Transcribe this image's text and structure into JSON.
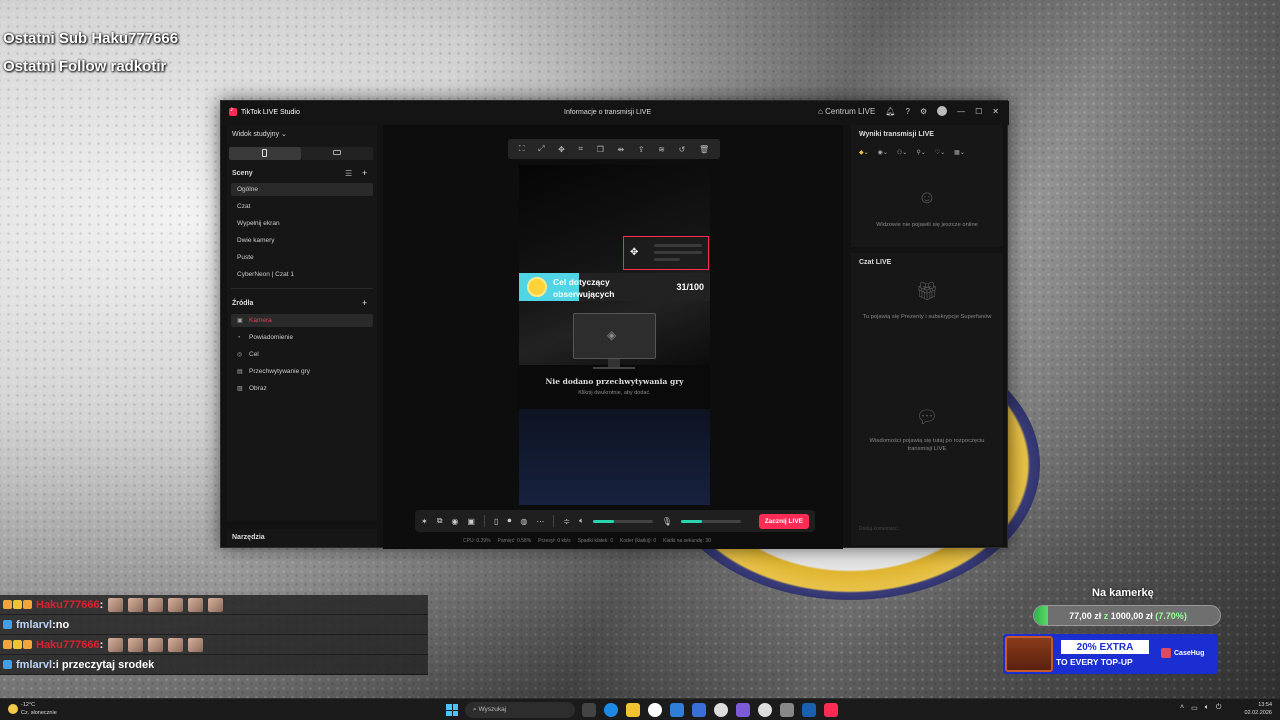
{
  "overlay": {
    "last_sub": "Ostatni Sub Haku777666",
    "last_follow": "Ostatni Follow radkotir"
  },
  "window": {
    "app_title": "TikTok LIVE Studio",
    "center_title": "Informacje o transmisji LIVE",
    "live_center": "Centrum LIVE"
  },
  "sidebar": {
    "view_dropdown": "Widok studyjny",
    "scenes_label": "Sceny",
    "scenes": [
      "Ogólne",
      "Czat",
      "Wypełnij ekran",
      "Dwie kamery",
      "Puste",
      "CyberNeon | Czat 1"
    ],
    "sources_label": "Źródła",
    "sources": [
      {
        "label": "Kamera",
        "icon": "camera-icon"
      },
      {
        "label": "Powiadomienie",
        "icon": "bell-icon"
      },
      {
        "label": "Cel",
        "icon": "target-icon"
      },
      {
        "label": "Przechwytywanie gry",
        "icon": "gamepad-icon"
      },
      {
        "label": "Obraz",
        "icon": "image-icon"
      }
    ],
    "tools_label": "Narzędzia"
  },
  "preview": {
    "goal_text": "Cel dotyczący obserwujących",
    "goal_count": "31/100",
    "game_title": "Nie dodano przechwytywania gry",
    "game_sub": "Kliknij dwukrotnie, aby dodać."
  },
  "controls": {
    "live_button": "Zacznij LIVE",
    "speaker_level": 0.35,
    "mic_level": 0.35
  },
  "stats": {
    "cpu": "CPU: 0.39%",
    "memory": "Pamięć: 0.58%",
    "bandwidth": "Przesył: 0 kb/s",
    "dropped": "Spadki klatek: 0",
    "encoder": "Koder (klatkiį): 0",
    "fps": "Klatki na sekundę: 30"
  },
  "right": {
    "results_title": "Wyniki transmisji LIVE",
    "results_empty": "Widzowie nie pojawili się jeszcze online",
    "chat_title": "Czat LIVE",
    "gifts_empty": "Tu pojawią się Prezenty i subskrypcje Superfanów",
    "messages_empty": "Wiadomości pojawią się tutaj po rozpoczęciu transmisji LIVE",
    "chat_placeholder": "Dodaj komentarz..."
  },
  "chat": [
    {
      "user": "Haku777666",
      "color": "red",
      "msg": "",
      "emotes": 6
    },
    {
      "user": "fmlarvl",
      "color": "blue",
      "msg": "no",
      "emotes": 0
    },
    {
      "user": "Haku777666",
      "color": "red",
      "msg": "",
      "emotes": 5
    },
    {
      "user": "fmlarvl",
      "color": "blue",
      "msg": "i przeczytaj srodek",
      "emotes": 0
    }
  ],
  "widgets": {
    "cam_title": "Na kamerkę",
    "progress_amount": "77,00 zł",
    "progress_z": "z",
    "progress_goal": "1000,00 zł",
    "progress_pct": "(7.70%)",
    "progress_fraction": 0.077,
    "ad_top": "20% EXTRA",
    "ad_bottom": "TO EVERY TOP-UP",
    "ad_brand": "CaseHug"
  },
  "taskbar": {
    "temp": "-12°C",
    "weather": "Cz. słonecznie",
    "search": "Wyszukaj",
    "time": "13:54",
    "date": "02.02.2026"
  }
}
